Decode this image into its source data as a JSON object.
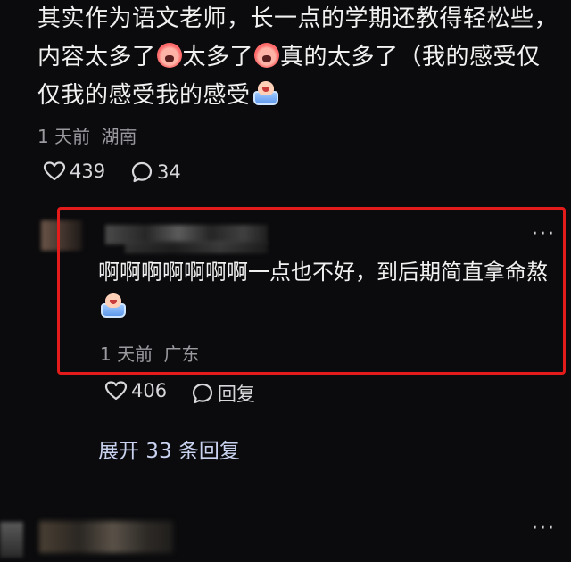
{
  "top_comment": {
    "text_part1": "其实作为语文老师，长一点的学期还教得轻松些，内容太多了",
    "text_part2": "太多了",
    "text_part3": "真的太多了（我的感受仅仅我的感受我的感受",
    "time": "1 天前",
    "location": "湖南",
    "likes": "439",
    "comments": "34"
  },
  "reply": {
    "text": "啊啊啊啊啊啊啊一点也不好，到后期简直拿命熬",
    "time": "1 天前",
    "location": "广东",
    "likes": "406",
    "reply_label": "回复",
    "more": "···"
  },
  "expand_replies": "展开 33 条回复",
  "next_comment": {
    "more": "···"
  },
  "colors": {
    "highlight": "#e31b1b",
    "background": "#0b0b0d",
    "link": "#c9d3f0"
  },
  "icons": [
    "heart-icon",
    "comment-bubble-icon",
    "more-icon",
    "cry-emoji",
    "face-emoji"
  ]
}
